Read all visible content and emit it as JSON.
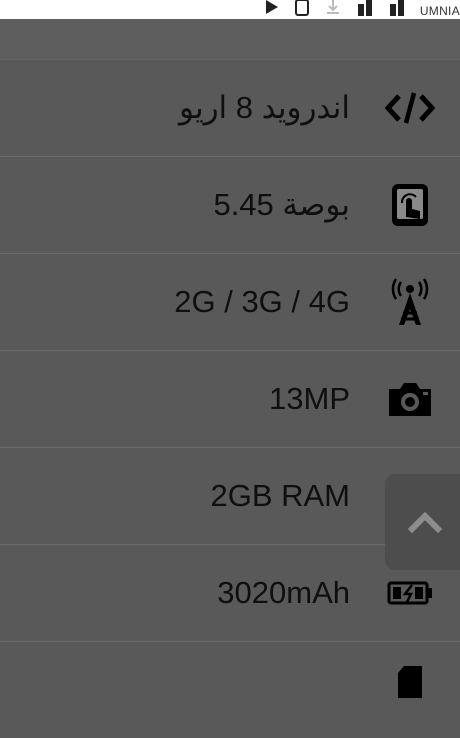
{
  "status_bar": {
    "carrier_text": "UMNIA",
    "icons": [
      "play-icon",
      "sim-icon",
      "download-icon",
      "signal-icon",
      "signal-icon"
    ]
  },
  "specs": [
    {
      "icon": "code-icon",
      "label": "اندرويد 8 اريو"
    },
    {
      "icon": "touchscreen-icon",
      "label": "5.45 بوصة"
    },
    {
      "icon": "antenna-icon",
      "label": "2G / 3G / 4G"
    },
    {
      "icon": "camera-icon",
      "label": "13MP"
    },
    {
      "icon": "chip-icon",
      "label": "2GB RAM"
    },
    {
      "icon": "battery-icon",
      "label": "3020mAh"
    },
    {
      "icon": "memory-card-icon",
      "label": ""
    }
  ],
  "scroll_top_button": {
    "icon": "chevron-up-icon"
  },
  "colors": {
    "overlay": "#595959",
    "text": "#0f0f0f",
    "icon": "#000000"
  }
}
